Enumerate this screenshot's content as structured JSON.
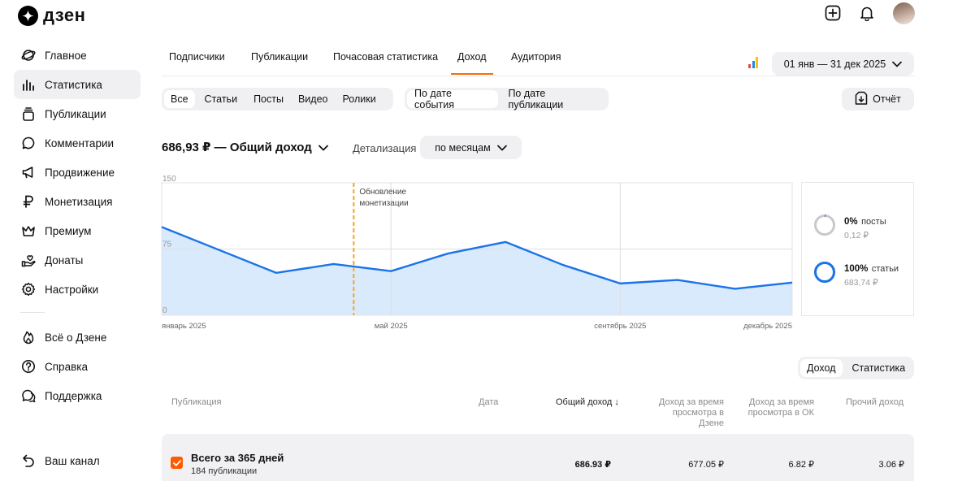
{
  "brand": {
    "name": "дзен"
  },
  "sidebar": {
    "items": [
      {
        "label": "Главное",
        "icon": "planet-icon"
      },
      {
        "label": "Статистика",
        "icon": "bar-chart-icon",
        "active": true
      },
      {
        "label": "Публикации",
        "icon": "stack-icon"
      },
      {
        "label": "Комментарии",
        "icon": "comment-icon"
      },
      {
        "label": "Продвижение",
        "icon": "megaphone-icon"
      },
      {
        "label": "Монетизация",
        "icon": "ruble-icon"
      },
      {
        "label": "Премиум",
        "icon": "crown-icon"
      },
      {
        "label": "Донаты",
        "icon": "donate-hand-icon"
      },
      {
        "label": "Настройки",
        "icon": "gear-icon"
      }
    ],
    "secondary": [
      {
        "label": "Всё о Дзене",
        "icon": "flame-icon"
      },
      {
        "label": "Справка",
        "icon": "help-icon"
      },
      {
        "label": "Поддержка",
        "icon": "support-chat-icon"
      }
    ],
    "channel": {
      "label": "Ваш канал",
      "icon": "back-arrow-icon"
    }
  },
  "tabs": [
    "Подписчики",
    "Публикации",
    "Почасовая статистика",
    "Доход",
    "Аудитория"
  ],
  "active_tab": "Доход",
  "date_range": "01 янв — 31 дек 2025",
  "content_filter": [
    "Все",
    "Статьи",
    "Посты",
    "Видео",
    "Ролики"
  ],
  "date_filter": [
    "По дате события",
    "По дате публикации"
  ],
  "report_label": "Отчёт",
  "summary": {
    "title": "686,93 ₽ — Общий доход",
    "detail_label": "Детализация",
    "detail_value": "по месяцам"
  },
  "chart_data": {
    "type": "area",
    "y_ticks": [
      "150",
      "75",
      "0"
    ],
    "ylim": [
      0,
      150
    ],
    "x_tick_labels": [
      {
        "label": "январь 2025",
        "month": 0
      },
      {
        "label": "май 2025",
        "month": 4
      },
      {
        "label": "сентябрь 2025",
        "month": 8
      },
      {
        "label": "декабрь 2025",
        "month": 11
      }
    ],
    "x": [
      "январь 2025",
      "февраль 2025",
      "март 2025",
      "апрель 2025",
      "май 2025",
      "июнь 2025",
      "июль 2025",
      "август 2025",
      "сентябрь 2025",
      "октябрь 2025",
      "ноябрь 2025",
      "декабрь 2025"
    ],
    "values": [
      100,
      48,
      58,
      50,
      70,
      83,
      57,
      36,
      40,
      30,
      37
    ],
    "annotation": {
      "text_line1": "Обновление",
      "text_line2": "монетизации",
      "month": 3.35
    },
    "colors": {
      "line": "#1a73e8",
      "fill": "#d9eafd",
      "annotation": "#f5a623"
    },
    "grid": true
  },
  "breakdown": [
    {
      "pct": "0%",
      "label": "посты",
      "sum": "0,12 ₽",
      "fraction": 0.0002
    },
    {
      "pct": "100%",
      "label": "статьи",
      "sum": "683,74 ₽",
      "fraction": 0.9998
    }
  ],
  "table_toggle": [
    "Доход",
    "Статистика"
  ],
  "table": {
    "headers": {
      "publication": "Публикация",
      "date": "Дата",
      "total": "Общий доход",
      "dzen_l1": "Доход за время",
      "dzen_l2": "просмотра в Дзене",
      "ok_l1": "Доход за время",
      "ok_l2": "просмотра в ОК",
      "other": "Прочий доход"
    },
    "total_row": {
      "title": "Всего за 365 дней",
      "subtitle": "184 публикации",
      "total": "686.93 ₽",
      "dzen": "677.05 ₽",
      "ok": "6.82 ₽",
      "other": "3.06 ₽"
    }
  },
  "colors": {
    "accent": "#ff6a00",
    "chart_blue": "#1a73e8"
  }
}
